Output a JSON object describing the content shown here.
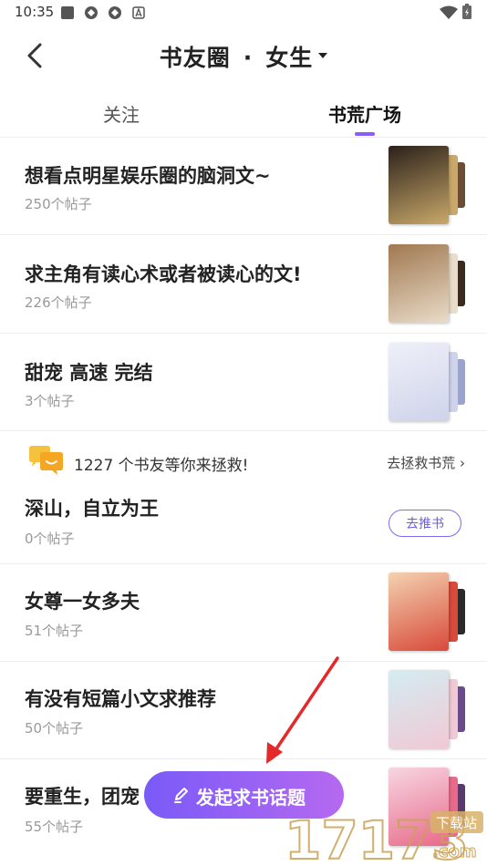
{
  "status_bar": {
    "time": "10:35"
  },
  "nav": {
    "title": "书友圈",
    "separator": "·",
    "filter": "女生"
  },
  "tabs": [
    {
      "label": "关注"
    },
    {
      "label": "书荒广场"
    }
  ],
  "topics": [
    {
      "title": "想看点明星娱乐圈的脑洞文~",
      "count": "250个帖子",
      "cover_colors": [
        "#2b211a",
        "#c9a86a",
        "#6b4d33"
      ]
    },
    {
      "title": "求主角有读心术或者被读心的文!",
      "count": "226个帖子",
      "cover_colors": [
        "#a07850",
        "#e9dcc9",
        "#3a2a20"
      ]
    },
    {
      "title": "甜宠 高速 完结",
      "count": "3个帖子",
      "cover_colors": [
        "#eef0f8",
        "#cfd3ea",
        "#9aa3cc"
      ]
    }
  ],
  "rescue": {
    "text": "1227 个书友等你来拯救!",
    "link": "去拯救书荒",
    "arrow": "›"
  },
  "rescue_topic": {
    "title": "深山，自立为王",
    "count": "0个帖子",
    "button": "去推书"
  },
  "topics2": [
    {
      "title": "女尊一女多夫",
      "count": "51个帖子",
      "cover_colors": [
        "#f3d2b0",
        "#d84a3a",
        "#2a2a2a"
      ]
    },
    {
      "title": "有没有短篇小文求推荐",
      "count": "50个帖子",
      "cover_colors": [
        "#d4ecf2",
        "#f0c9d4",
        "#6a4b8a"
      ]
    },
    {
      "title": "要重生，团宠",
      "count": "55个帖子",
      "cover_colors": [
        "#f7d6e2",
        "#e86a8a",
        "#5a3a6a"
      ]
    }
  ],
  "fab": {
    "label": "发起求书话题"
  },
  "watermark": {
    "text": "17173",
    "suffix": ".com",
    "badge": "下载站"
  },
  "colors": {
    "accent": "#8b5cf6",
    "arrow": "#e5282a"
  }
}
